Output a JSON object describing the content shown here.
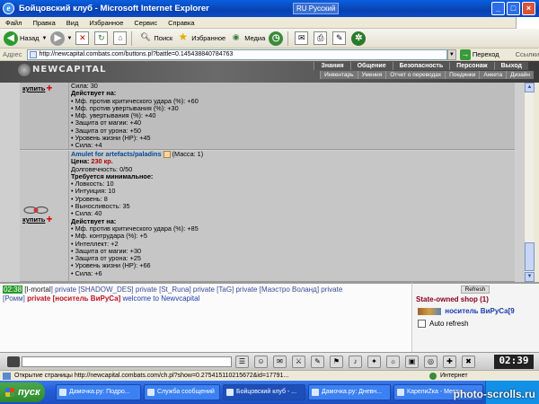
{
  "window": {
    "title": "Бойцовский клуб - Microsoft Internet Explorer",
    "language": "RU Русский",
    "btn_min": "_",
    "btn_max": "□",
    "btn_close": "×"
  },
  "menu": [
    "Файл",
    "Правка",
    "Вид",
    "Избранное",
    "Сервис",
    "Справка"
  ],
  "toolbar": {
    "back": "Назад",
    "search": "Поиск",
    "favorites": "Избранное",
    "media": "Медиа"
  },
  "address": {
    "label": "Адрес",
    "url": "http://newcapital.combats.com/buttons.pl?battle=0.145438840784763",
    "go": "Переход",
    "links": "Ссылки"
  },
  "game": {
    "logo": "NEWCAPITAL",
    "nav_top": [
      "Знания",
      "Общение",
      "Безопасность",
      "Персонаж",
      "Выход"
    ],
    "nav_bottom": [
      "Инвентарь",
      "Умения",
      "Отчет о переводах",
      "Поединки",
      "Анкета",
      "Дизайн"
    ]
  },
  "items": [
    {
      "buy_label": "купить",
      "lines": [
        {
          "t": "Сила: 30",
          "bold": false
        },
        {
          "t": "Действует на:",
          "bold": true
        },
        {
          "t": "• Мф. против критического удара (%): +60",
          "bold": false
        },
        {
          "t": "• Мф. против увертывания (%): +30",
          "bold": false
        },
        {
          "t": "• Мф. увертывания (%): +40",
          "bold": false
        },
        {
          "t": "• Защита от магии: +40",
          "bold": false
        },
        {
          "t": "• Защита от урона: +50",
          "bold": false
        },
        {
          "t": "• Уровень жизни (HP): +45",
          "bold": false
        },
        {
          "t": "• Сила: +4",
          "bold": false
        }
      ]
    },
    {
      "buy_label": "купить",
      "name": "Amulet for artefacts/paladins",
      "mass": "(Масса: 1)",
      "price_label": "Цена:",
      "price_value": "230 кр.",
      "durability": "Долговечность: 0/50",
      "lines": [
        {
          "t": "Требуется минимальное:",
          "bold": true
        },
        {
          "t": "• Ловкость: 10",
          "bold": false
        },
        {
          "t": "• Интуиция: 10",
          "bold": false
        },
        {
          "t": "• Уровень: 8",
          "bold": false
        },
        {
          "t": "• Выносливость: 35",
          "bold": false
        },
        {
          "t": "• Сила: 40",
          "bold": false
        },
        {
          "t": "Действует на:",
          "bold": true
        },
        {
          "t": "• Мф. против критического удара (%): +85",
          "bold": false
        },
        {
          "t": "• Мф. контрудара (%): +5",
          "bold": false
        },
        {
          "t": "• Интеллект: +2",
          "bold": false
        },
        {
          "t": "• Защита от магии: +30",
          "bold": false
        },
        {
          "t": "• Защита от урона: +25",
          "bold": false
        },
        {
          "t": "• Уровень жизни (HP): +66",
          "bold": false
        },
        {
          "t": "• Сила: +6",
          "bold": false
        }
      ]
    }
  ],
  "chat": {
    "time": "02:38",
    "line1_parts": [
      {
        "t": "[",
        "c": "c-dark"
      },
      {
        "t": "I-mortal",
        "c": "c-dark"
      },
      {
        "t": "] private [SHADOW_DES] private [St_Runa] private [TaG] private [Маэстро Воланд] private",
        "c": "c-green"
      }
    ],
    "line2_parts": [
      {
        "t": "[Ромм] ",
        "c": "c-green"
      },
      {
        "t": "private [носитель ВиРуСа]",
        "c": "c-red"
      },
      {
        "t": " welcome to Newvcapital",
        "c": "c-blue"
      }
    ]
  },
  "panel": {
    "refresh": "Refresh",
    "shop": "State-owned shop (1)",
    "user": "носитель ВиРуСа[9",
    "auto_refresh": "Auto refresh"
  },
  "gamebar": {
    "clock": "02:39",
    "buttons": [
      "☰",
      "☺",
      "✉",
      "⚔",
      "✎",
      "⚑",
      "♪",
      "✦",
      "☼",
      "▣",
      "◎",
      "✚",
      "✖"
    ]
  },
  "status": {
    "text": "Открытие страницы http://newcapital.combats.com/ch.pl?show=0.275415110215672&id=17791...",
    "zone": "Интернет"
  },
  "taskbar": {
    "start": "пуск",
    "tasks": [
      "Дамочка.ру: Подро...",
      "Служба сообщений",
      "Бойцовский клуб - ...",
      "Дамочка.ру: Дневн...",
      "КарелиZка - Messa..."
    ]
  },
  "watermark": "photo-scrolls.ru"
}
